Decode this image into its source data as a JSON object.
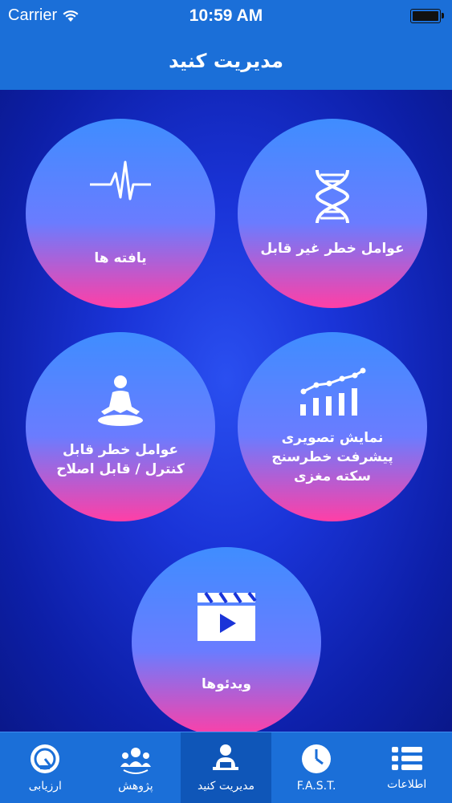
{
  "status_bar": {
    "carrier": "Carrier",
    "time": "10:59 AM",
    "battery_level": 1.0
  },
  "nav_bar": {
    "title": "مدیریت کنید"
  },
  "circles": [
    {
      "id": "non-modifiable-risk",
      "icon": "dna-icon",
      "label": "عوامل خطر غیر قابل"
    },
    {
      "id": "findings",
      "icon": "heartbeat-icon",
      "label": "یافته ها"
    },
    {
      "id": "visual-risk-meter",
      "icon": "bar-chart-icon",
      "label": "نمایش تصویری\nپیشرفت خطرسنج\nسکته مغزی"
    },
    {
      "id": "modifiable-risk",
      "icon": "meditation-icon",
      "label": "عوامل خطر قابل\nکنترل / قابل اصلاح"
    },
    {
      "id": "videos",
      "icon": "video-clapper-icon",
      "label": "ویدئوها"
    }
  ],
  "tabs": [
    {
      "label": "ارزیابی",
      "icon": "gauge-icon",
      "active": false
    },
    {
      "label": "پژوهش",
      "icon": "people-icon",
      "active": false
    },
    {
      "label": "مدیریت کنید",
      "icon": "manager-icon",
      "active": true
    },
    {
      "label": "F.A.S.T.",
      "icon": "clock-icon",
      "active": false
    },
    {
      "label": "اطلاعات",
      "icon": "list-icon",
      "active": false
    }
  ],
  "colors": {
    "bar": "#1b6fd8",
    "active_tab": "#0f56b8",
    "background": "#1a34d8"
  }
}
